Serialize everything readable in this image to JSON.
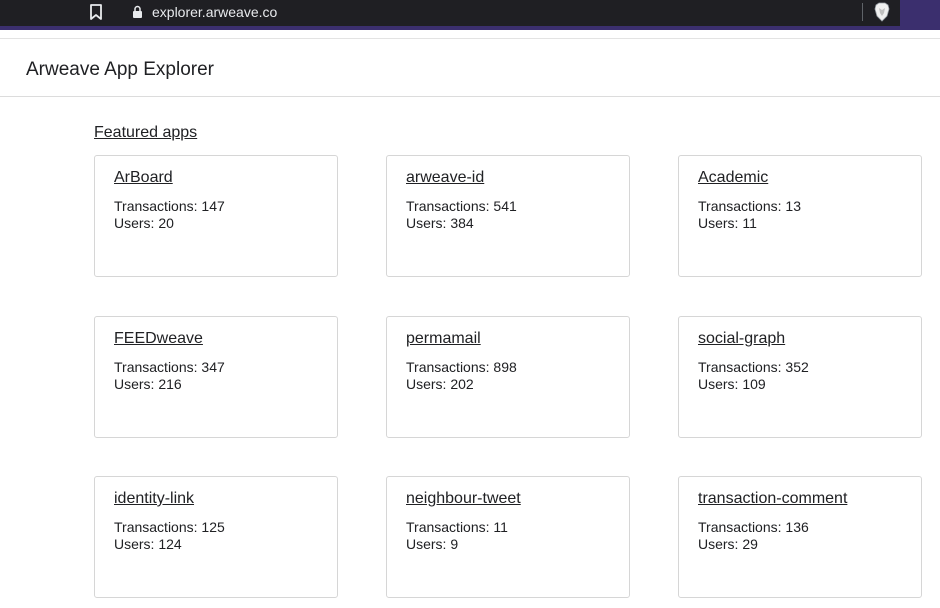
{
  "browser": {
    "url": "explorer.arweave.co",
    "icons": [
      "bookmark-icon",
      "lock-icon",
      "brave-shield-icon"
    ]
  },
  "header": {
    "title": "Arweave App Explorer"
  },
  "section": {
    "title": "Featured apps"
  },
  "apps": [
    {
      "name": "ArBoard",
      "transactions": "Transactions: 147",
      "users": "Users: 20"
    },
    {
      "name": "arweave-id",
      "transactions": "Transactions: 541",
      "users": "Users: 384"
    },
    {
      "name": "Academic",
      "transactions": "Transactions: 13",
      "users": "Users: 11"
    },
    {
      "name": "FEEDweave",
      "transactions": "Transactions: 347",
      "users": "Users: 216"
    },
    {
      "name": "permamail",
      "transactions": "Transactions: 898",
      "users": "Users: 202"
    },
    {
      "name": "social-graph",
      "transactions": "Transactions: 352",
      "users": "Users: 109"
    },
    {
      "name": "identity-link",
      "transactions": "Transactions: 125",
      "users": "Users: 124"
    },
    {
      "name": "neighbour-tweet",
      "transactions": "Transactions: 11",
      "users": "Users: 9"
    },
    {
      "name": "transaction-comment",
      "transactions": "Transactions: 136",
      "users": "Users: 29"
    }
  ],
  "colors": {
    "browser_frame": "#3b2f6e",
    "address_bar": "#1f1f23",
    "text": "#202124",
    "card_border": "#d6d6d6"
  }
}
